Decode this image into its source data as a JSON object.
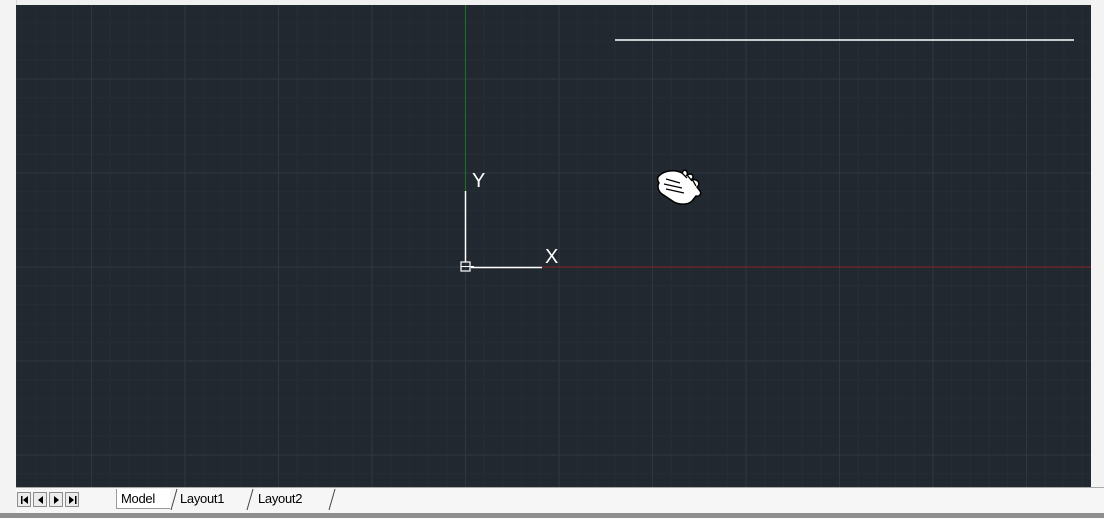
{
  "canvas": {
    "background": "#212830",
    "grid_color": "#2f3742",
    "ucs_icon": {
      "y_label": "Y",
      "x_label": "X",
      "color": "#ffffff",
      "origin_icon": "square-origin-icon"
    },
    "axis_colors": {
      "x_axis": "#8b2323",
      "y_axis": "#1e6b2a"
    },
    "cursor_icon": "pan-hand-icon"
  },
  "tabbar": {
    "nav_buttons": [
      {
        "icon": "first-tab-icon"
      },
      {
        "icon": "previous-tab-icon"
      },
      {
        "icon": "next-tab-icon"
      },
      {
        "icon": "last-tab-icon"
      }
    ],
    "tabs": [
      {
        "label": "Model",
        "active": true
      },
      {
        "label": "Layout1",
        "active": false
      },
      {
        "label": "Layout2",
        "active": false
      }
    ]
  }
}
